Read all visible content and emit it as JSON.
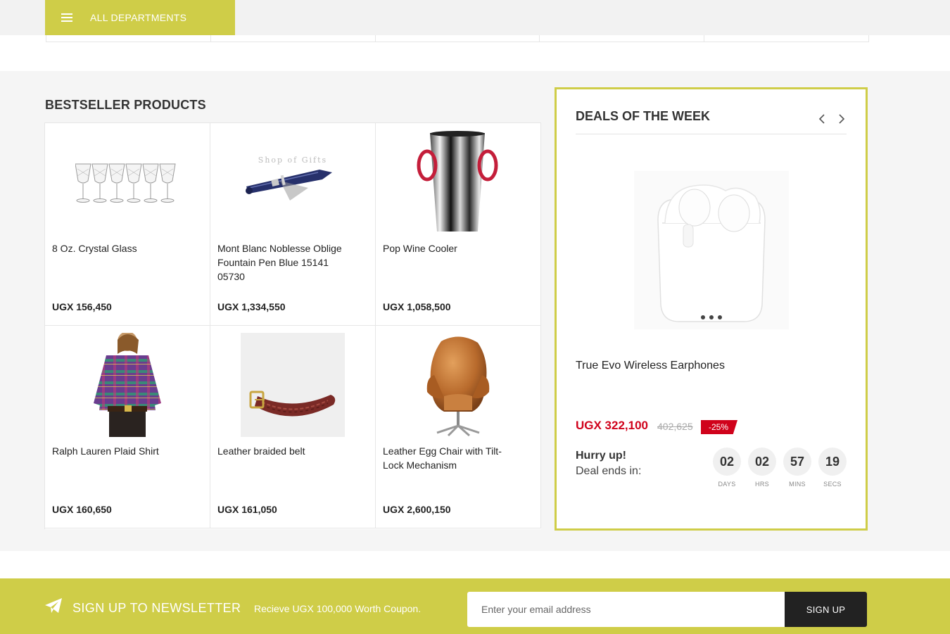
{
  "header": {
    "departments_label": "ALL DEPARTMENTS"
  },
  "bestseller": {
    "title": "BESTSELLER PRODUCTS",
    "products": [
      {
        "name": "8 Oz. Crystal Glass",
        "price": "UGX 156,450",
        "icon": "crystal-glasses-image"
      },
      {
        "name": "Mont Blanc Noblesse Oblige Fountain Pen Blue 15141 05730",
        "price": "UGX 1,334,550",
        "icon": "fountain-pen-image",
        "image_caption": "Shop of Gifts"
      },
      {
        "name": "Pop Wine Cooler",
        "price": "UGX 1,058,500",
        "icon": "wine-cooler-image"
      },
      {
        "name": "Ralph Lauren Plaid Shirt",
        "price": "UGX 160,650",
        "icon": "plaid-shirt-image"
      },
      {
        "name": "Leather braided belt",
        "price": "UGX 161,050",
        "icon": "braided-belt-image"
      },
      {
        "name": "Leather Egg Chair with Tilt-Lock Mechanism",
        "price": "UGX 2,600,150",
        "icon": "egg-chair-image"
      }
    ]
  },
  "deals": {
    "title": "DEALS OF THE WEEK",
    "product_name": "True Evo Wireless Earphones",
    "price": "UGX 322,100",
    "old_price": "402,625",
    "discount": "-25%",
    "hurry": "Hurry up!",
    "ends": "Deal ends in:",
    "countdown": [
      {
        "value": "02",
        "label": "DAYS"
      },
      {
        "value": "02",
        "label": "HRS"
      },
      {
        "value": "57",
        "label": "MINS"
      },
      {
        "value": "19",
        "label": "SECS"
      }
    ]
  },
  "newsletter": {
    "title": "SIGN UP TO NEWSLETTER",
    "subtitle": "Recieve UGX 100,000 Worth Coupon.",
    "placeholder": "Enter your email address",
    "button": "SIGN UP"
  },
  "colors": {
    "accent": "#cfcd48",
    "sale": "#d0021b",
    "dark": "#222222"
  }
}
